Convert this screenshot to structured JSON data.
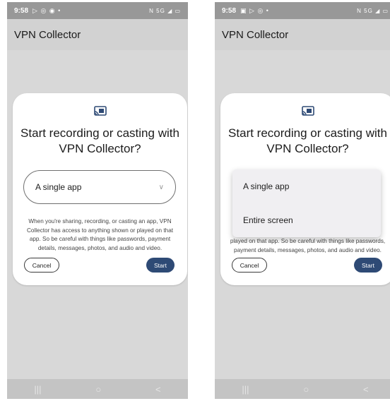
{
  "screens": [
    {
      "status": {
        "time": "9:58",
        "notifications": "▷ ◎ ◉ •",
        "signal": "N 5G ◢ ▭"
      },
      "app_title": "VPN Collector",
      "dialog": {
        "title": "Start recording or casting with VPN Collector?",
        "selected_option": "A single app",
        "description": "When you're sharing, recording, or casting an app, VPN Collector has access to anything shown or played on that app. So be careful with things like passwords, payment details, messages, photos, and audio and video.",
        "cancel_label": "Cancel",
        "start_label": "Start"
      },
      "nav": {
        "recents": "|||",
        "home": "○",
        "back": "<"
      }
    },
    {
      "status": {
        "time": "9:58",
        "notifications": "▣ ▷ ◎ •",
        "signal": "N 5G ◢ ▭"
      },
      "app_title": "VPN Collector",
      "dialog": {
        "title": "Start recording or casting with VPN Collector?",
        "menu_options": [
          "A single app",
          "Entire screen"
        ],
        "description_partial": "played on that app. So be careful with things like passwords, payment details, messages, photos, and audio and video.",
        "cancel_label": "Cancel",
        "start_label": "Start"
      },
      "nav": {
        "recents": "|||",
        "home": "○",
        "back": "<"
      }
    }
  ]
}
